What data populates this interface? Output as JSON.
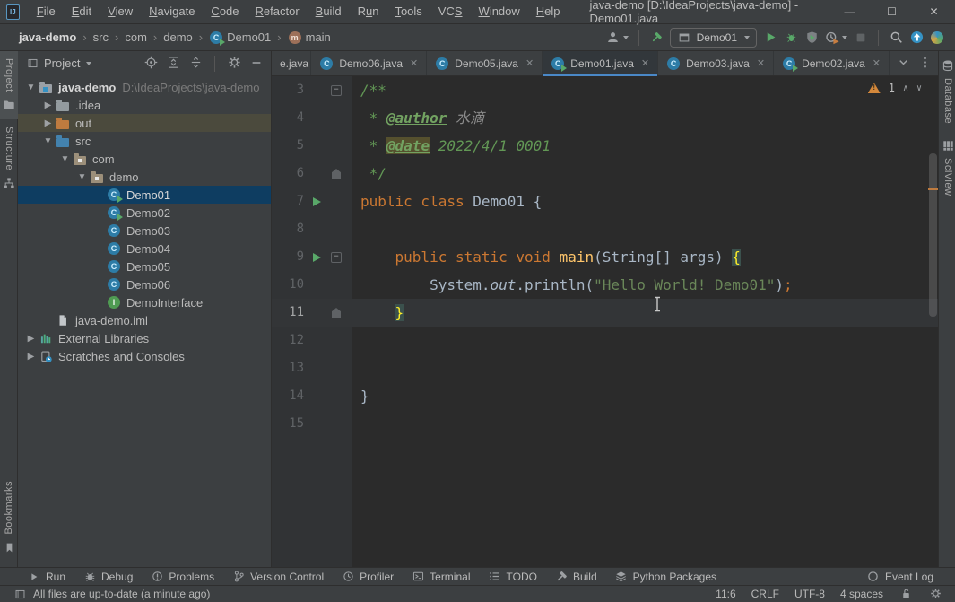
{
  "window": {
    "title": "java-demo [D:\\IdeaProjects\\java-demo] - Demo01.java",
    "menu": [
      {
        "label": "File",
        "u": 0
      },
      {
        "label": "Edit",
        "u": 0
      },
      {
        "label": "View",
        "u": 0
      },
      {
        "label": "Navigate",
        "u": 0
      },
      {
        "label": "Code",
        "u": 0
      },
      {
        "label": "Refactor",
        "u": 0
      },
      {
        "label": "Build",
        "u": 0
      },
      {
        "label": "Run",
        "u": 1
      },
      {
        "label": "Tools",
        "u": 0
      },
      {
        "label": "VCS",
        "u": 2
      },
      {
        "label": "Window",
        "u": 0
      },
      {
        "label": "Help",
        "u": 0
      }
    ],
    "controls": [
      {
        "name": "minimize",
        "glyph": "—"
      },
      {
        "name": "maximize",
        "glyph": "☐"
      },
      {
        "name": "close",
        "glyph": "✕"
      }
    ]
  },
  "navbar": {
    "breadcrumbs": [
      {
        "label": "java-demo",
        "bold": true
      },
      {
        "label": "src"
      },
      {
        "label": "com"
      },
      {
        "label": "demo"
      },
      {
        "label": "Demo01",
        "icon": "class-run"
      },
      {
        "label": "main",
        "icon": "method"
      }
    ],
    "run_config": "Demo01",
    "toolbar": [
      {
        "icon": "user",
        "dropdown": true
      },
      {
        "sep": true
      },
      {
        "icon": "hammer"
      },
      {
        "combo": true
      },
      {
        "icon": "play"
      },
      {
        "icon": "debug"
      },
      {
        "icon": "coverage"
      },
      {
        "icon": "profiler",
        "dropdown": true
      },
      {
        "icon": "stop"
      },
      {
        "sep": true
      },
      {
        "icon": "search"
      },
      {
        "icon": "update"
      },
      {
        "icon": "sphere"
      }
    ]
  },
  "left_stripe": {
    "top": [
      {
        "label": "Project",
        "icon": "folder-stripe",
        "active": true
      },
      {
        "label": "Structure",
        "icon": "structure",
        "active": false
      }
    ],
    "bottom": [
      {
        "label": "Bookmarks",
        "icon": "bookmark",
        "active": false
      }
    ]
  },
  "right_stripe": [
    {
      "label": "Database",
      "icon": "db"
    },
    {
      "label": "SciView",
      "icon": "grid"
    }
  ],
  "project_panel": {
    "title": "Project",
    "header_icons": [
      "target",
      "expand-all",
      "collapse-all",
      "sep",
      "gear",
      "hide"
    ],
    "tree": [
      {
        "depth": 0,
        "arrow": "down",
        "icon": "module",
        "label": "java-demo",
        "suffix": "D:\\IdeaProjects\\java-demo",
        "bold": true
      },
      {
        "depth": 1,
        "arrow": "right",
        "icon": "folder",
        "label": ".idea"
      },
      {
        "depth": 1,
        "arrow": "right",
        "icon": "folder-orange",
        "label": "out",
        "row": "hover"
      },
      {
        "depth": 1,
        "arrow": "down",
        "icon": "folder-blue",
        "label": "src"
      },
      {
        "depth": 2,
        "arrow": "down",
        "icon": "package",
        "label": "com"
      },
      {
        "depth": 3,
        "arrow": "down",
        "icon": "package",
        "label": "demo"
      },
      {
        "depth": 4,
        "icon": "class-run",
        "label": "Demo01",
        "selected": true
      },
      {
        "depth": 4,
        "icon": "class-run",
        "label": "Demo02"
      },
      {
        "depth": 4,
        "icon": "class",
        "label": "Demo03"
      },
      {
        "depth": 4,
        "icon": "class",
        "label": "Demo04"
      },
      {
        "depth": 4,
        "icon": "class",
        "label": "Demo05"
      },
      {
        "depth": 4,
        "icon": "class",
        "label": "Demo06"
      },
      {
        "depth": 4,
        "icon": "interface",
        "label": "DemoInterface"
      },
      {
        "depth": 1,
        "icon": "iml",
        "label": "java-demo.iml"
      },
      {
        "depth": 0,
        "arrow": "right",
        "icon": "libs",
        "label": "External Libraries"
      },
      {
        "depth": 0,
        "arrow": "right",
        "icon": "scratches",
        "label": "Scratches and Consoles"
      }
    ]
  },
  "editor": {
    "tabs": [
      {
        "label": "e.java",
        "icon": null,
        "first": true
      },
      {
        "label": "Demo06.java",
        "icon": "class"
      },
      {
        "label": "Demo05.java",
        "icon": "class"
      },
      {
        "label": "Demo01.java",
        "icon": "class-run",
        "active": true
      },
      {
        "label": "Demo03.java",
        "icon": "class"
      },
      {
        "label": "Demo02.java",
        "icon": "class-run"
      }
    ],
    "close_glyph": "✕",
    "warning_count": "1",
    "lines": [
      {
        "n": "3",
        "fold": "start",
        "tokens": [
          [
            "/**",
            "c"
          ]
        ]
      },
      {
        "n": "4",
        "tokens": [
          [
            " * ",
            "c"
          ],
          [
            "@author",
            "cd"
          ],
          [
            " ",
            "c"
          ],
          [
            "水滴",
            "ci"
          ]
        ]
      },
      {
        "n": "5",
        "tokens": [
          [
            " * ",
            "c"
          ],
          [
            "@date",
            "cd hl"
          ],
          [
            " ",
            "c"
          ],
          [
            "2022/4/1 0001",
            "c"
          ]
        ]
      },
      {
        "n": "6",
        "fold": "end",
        "tokens": [
          [
            " */",
            "c"
          ]
        ]
      },
      {
        "n": "7",
        "run": true,
        "tokens": [
          [
            "public class ",
            "k"
          ],
          [
            "Demo01 {",
            "p"
          ]
        ]
      },
      {
        "n": "8",
        "tokens": []
      },
      {
        "n": "9",
        "run": true,
        "fold": "start",
        "tokens": [
          [
            "    ",
            "p"
          ],
          [
            "public static void ",
            "k"
          ],
          [
            "main",
            "m"
          ],
          [
            "(String[] args) ",
            "p"
          ],
          [
            "{",
            "bh"
          ]
        ]
      },
      {
        "n": "10",
        "tokens": [
          [
            "        ",
            "p"
          ],
          [
            "System.",
            "p"
          ],
          [
            "out",
            "p f"
          ],
          [
            ".println(",
            "p"
          ],
          [
            "\"Hello World! Demo01\"",
            "s"
          ],
          [
            ")",
            "p"
          ],
          [
            ";",
            "k"
          ]
        ]
      },
      {
        "n": "11",
        "fold": "end",
        "current": true,
        "tokens": [
          [
            "    ",
            "p"
          ],
          [
            "}",
            "bh"
          ]
        ]
      },
      {
        "n": "12",
        "tokens": []
      },
      {
        "n": "13",
        "tokens": []
      },
      {
        "n": "14",
        "tokens": [
          [
            "}",
            "p"
          ]
        ]
      },
      {
        "n": "15",
        "tokens": []
      }
    ]
  },
  "bottom_bar": {
    "left": [
      {
        "label": "Run",
        "icon": "play-sm"
      },
      {
        "label": "Debug",
        "icon": "bug-sm"
      },
      {
        "label": "Problems",
        "icon": "problems"
      },
      {
        "label": "Version Control",
        "icon": "branch"
      },
      {
        "label": "Profiler",
        "icon": "clock"
      },
      {
        "label": "Terminal",
        "icon": "terminal"
      },
      {
        "label": "TODO",
        "icon": "todo"
      },
      {
        "label": "Build",
        "icon": "hammer-sm"
      },
      {
        "label": "Python Packages",
        "icon": "layers"
      }
    ],
    "right": [
      {
        "label": "Event Log",
        "icon": "event"
      }
    ]
  },
  "status_bar": {
    "message": "All files are up-to-date (a minute ago)",
    "position": "11:6",
    "line_separator": "CRLF",
    "encoding": "UTF-8",
    "indent": "4 spaces",
    "icons": [
      "lock",
      "gear-sm"
    ]
  },
  "colors": {
    "accent_blue": "#4A88C7",
    "run_green": "#59A869",
    "warning_orange": "#D4883B",
    "editor_bg": "#2b2b2b",
    "panel_bg": "#3c3f41",
    "selection_blue": "#0e3d61"
  }
}
